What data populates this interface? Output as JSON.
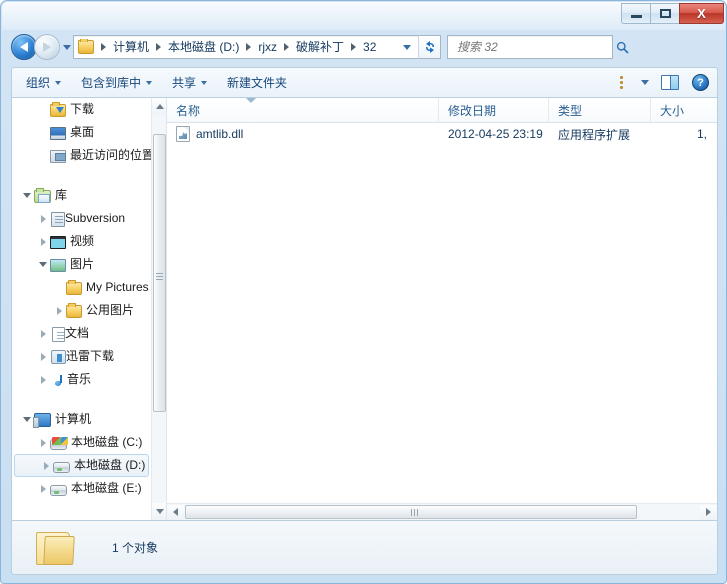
{
  "window": {
    "minimize_label": "最小化",
    "maximize_label": "最大化",
    "close_label": "X"
  },
  "navigation": {
    "back_label": "后退",
    "forward_label": "前进",
    "history_label": "最近浏览的位置"
  },
  "address": {
    "folder_icon": "folder-icon",
    "crumbs": [
      "计算机",
      "本地磁盘 (D:)",
      "rjxz",
      "破解补丁",
      "32"
    ],
    "dropdown_label": "▼",
    "refresh_label": "↻"
  },
  "search": {
    "placeholder": "搜索 32",
    "value": "",
    "icon": "search-icon"
  },
  "toolbar": {
    "items": [
      {
        "label": "组织",
        "has_caret": true
      },
      {
        "label": "包含到库中",
        "has_caret": true
      },
      {
        "label": "共享",
        "has_caret": true
      },
      {
        "label": "新建文件夹",
        "has_caret": false
      }
    ],
    "view_icon": "list-view-icon",
    "view_caret": "▼",
    "preview_icon": "preview-pane-icon",
    "help_icon": "help-icon",
    "help_glyph": "?"
  },
  "sidebar": {
    "items": [
      {
        "label": "下载",
        "icon": "download-folder-icon",
        "indent": 1,
        "twisty": "none",
        "selected": false
      },
      {
        "label": "桌面",
        "icon": "desktop-icon",
        "indent": 1,
        "twisty": "none",
        "selected": false
      },
      {
        "label": "最近访问的位置",
        "icon": "recent-places-icon",
        "indent": 1,
        "twisty": "none",
        "selected": false
      },
      {
        "label": "",
        "icon": "spacer",
        "indent": 0,
        "twisty": "none",
        "selected": false
      },
      {
        "label": "库",
        "icon": "library-icon",
        "indent": 0,
        "twisty": "open",
        "selected": false
      },
      {
        "label": "Subversion",
        "icon": "subversion-icon",
        "indent": 1,
        "twisty": "closed",
        "selected": false
      },
      {
        "label": "视频",
        "icon": "video-icon",
        "indent": 1,
        "twisty": "closed",
        "selected": false
      },
      {
        "label": "图片",
        "icon": "picture-icon",
        "indent": 1,
        "twisty": "open",
        "selected": false
      },
      {
        "label": "My Pictures",
        "icon": "folder-icon",
        "indent": 2,
        "twisty": "none",
        "selected": false
      },
      {
        "label": "公用图片",
        "icon": "folder-icon",
        "indent": 2,
        "twisty": "closed",
        "selected": false
      },
      {
        "label": "文档",
        "icon": "document-icon",
        "indent": 1,
        "twisty": "closed",
        "selected": false
      },
      {
        "label": "迅雷下载",
        "icon": "thunder-download-icon",
        "indent": 1,
        "twisty": "closed",
        "selected": false
      },
      {
        "label": "音乐",
        "icon": "music-icon",
        "indent": 1,
        "twisty": "closed",
        "selected": false
      },
      {
        "label": "",
        "icon": "spacer",
        "indent": 0,
        "twisty": "none",
        "selected": false
      },
      {
        "label": "计算机",
        "icon": "computer-icon",
        "indent": 0,
        "twisty": "open",
        "selected": false
      },
      {
        "label": "本地磁盘 (C:)",
        "icon": "windows-drive-icon",
        "indent": 1,
        "twisty": "closed",
        "selected": false
      },
      {
        "label": "本地磁盘 (D:)",
        "icon": "drive-icon",
        "indent": 1,
        "twisty": "closed",
        "selected": true
      },
      {
        "label": "本地磁盘 (E:)",
        "icon": "drive-icon",
        "indent": 1,
        "twisty": "closed",
        "selected": false
      }
    ]
  },
  "filelist": {
    "columns": [
      {
        "key": "name",
        "label": "名称"
      },
      {
        "key": "date",
        "label": "修改日期"
      },
      {
        "key": "type",
        "label": "类型"
      },
      {
        "key": "size",
        "label": "大小"
      }
    ],
    "rows": [
      {
        "name": "amtlib.dll",
        "date": "2012-04-25 23:19",
        "type": "应用程序扩展",
        "size": "1,",
        "icon": "dll-file-icon"
      }
    ]
  },
  "statusbar": {
    "folder_icon": "open-folder-icon",
    "text": "1 个对象"
  }
}
